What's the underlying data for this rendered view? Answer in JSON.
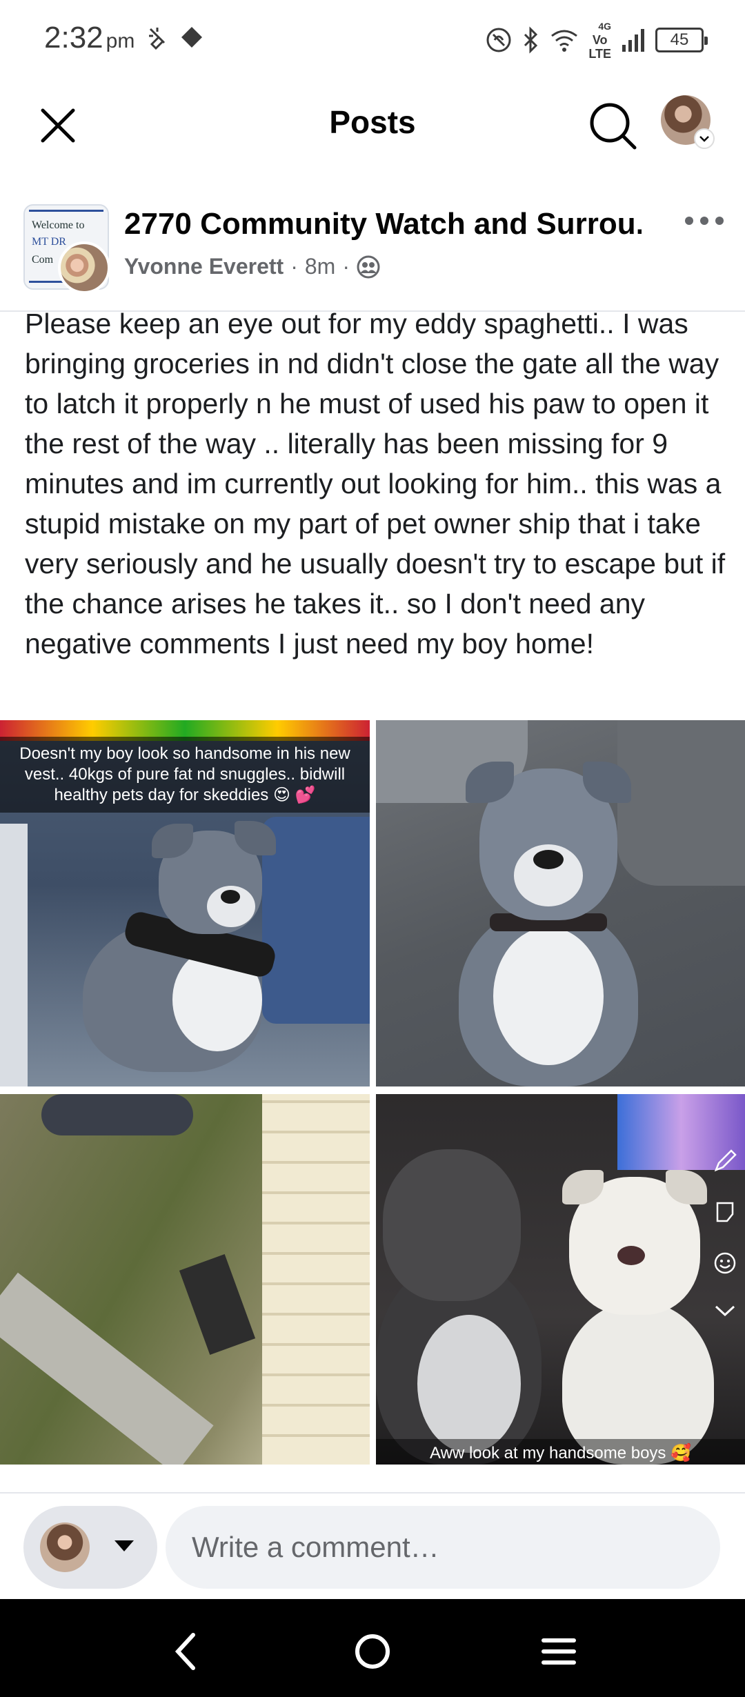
{
  "status_bar": {
    "time": "2:32",
    "ampm": "pm",
    "network_label": "Vo\nLTE",
    "network_gen": "4G",
    "battery": "45"
  },
  "header": {
    "title": "Posts"
  },
  "post": {
    "group_name": "2770 Community Watch and Surrou...",
    "author": "Yvonne Everett",
    "time_ago": "8m",
    "group_avatar_text": [
      "Welcome to",
      "MT DR",
      "Com"
    ],
    "text": "Please keep an eye out for my eddy spaghetti.. I was bringing groceries in nd didn't close the gate all the way to latch it properly n he must of used his paw to open it the rest of the way .. literally has been missing for 9 minutes and im currently out looking for him.. this was a stupid mistake on my part of pet owner ship that i take very seriously and he usually doesn't try to escape but if the chance arises he takes it.. so I don't need any negative comments I just need my boy home!",
    "photos": [
      {
        "caption": "Doesn't my boy look so handsome in his new vest.. 40kgs of pure fat nd snuggles.. bidwill healthy pets day for skeddies 😍 💕"
      },
      {
        "caption": ""
      },
      {
        "caption": ""
      },
      {
        "caption": "Aww look at my handsome boys 🥰"
      }
    ]
  },
  "comment": {
    "placeholder": "Write a comment…"
  },
  "icons": {
    "close": "close-icon",
    "search": "search-icon",
    "more": "more-icon",
    "privacy": "group-privacy-icon",
    "back": "back-icon",
    "home": "home-icon",
    "recents": "recents-icon"
  }
}
